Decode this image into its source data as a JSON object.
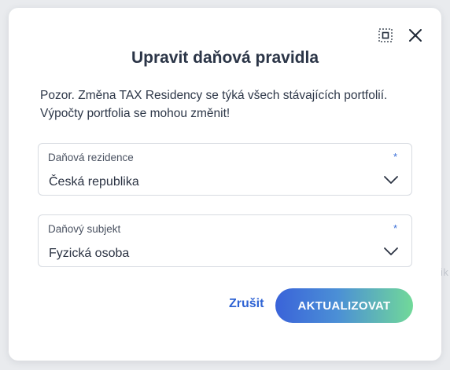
{
  "backdrop": {
    "partial_text": "ik"
  },
  "dialog": {
    "title": "Upravit daňová pravidla",
    "warning": "Pozor. Změna TAX Residency se týká všech stávajících portfolií. Výpočty portfolia se mohou změnit!",
    "icons": {
      "expand": "fullscreen-icon",
      "close": "close-icon"
    }
  },
  "fields": [
    {
      "label": "Daňová rezidence",
      "required_mark": "*",
      "value": "Česká republika"
    },
    {
      "label": "Daňový subjekt",
      "required_mark": "*",
      "value": "Fyzická osoba"
    }
  ],
  "actions": {
    "cancel_label": "Zrušit",
    "update_label": "AKTUALIZOVAT"
  },
  "colors": {
    "title": "#2b3547",
    "link": "#2e63d4",
    "accent_start": "#3a63d9",
    "accent_end": "#71d999",
    "required": "#3a6fd8"
  }
}
